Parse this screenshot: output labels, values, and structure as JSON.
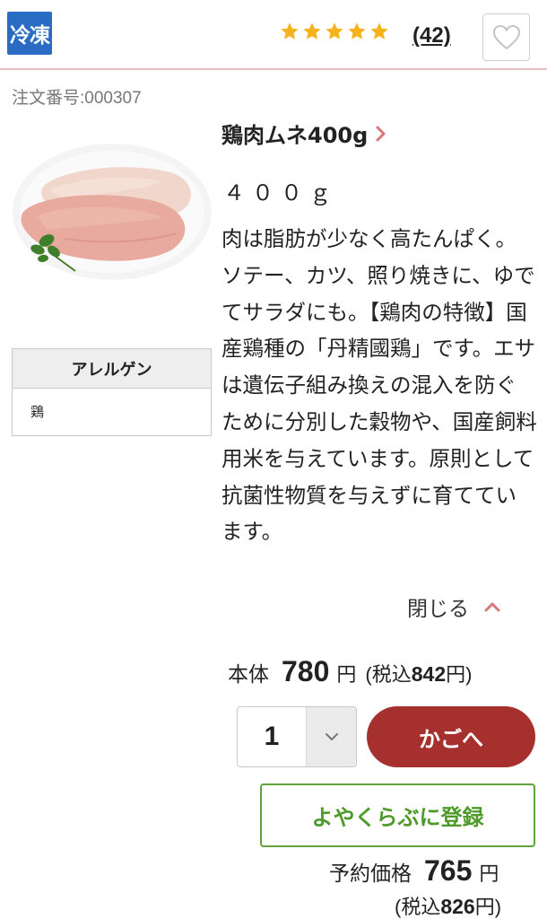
{
  "header": {
    "badge_label": "冷凍",
    "rating": 5,
    "rating_max": 5,
    "review_count": "(42)",
    "favorite_icon": "heart-outline-icon"
  },
  "order_number": "注文番号:000307",
  "allergen": {
    "heading": "アレルゲン",
    "value": "鶏"
  },
  "product": {
    "name": "鶏肉ムネ400g",
    "weight": "４００ｇ",
    "description": "肉は脂肪が少なく高たんぱく。ソテー、カツ、照り焼きに、ゆでてサラダにも。【鶏肉の特徴】国産鶏種の「丹精國鶏」です。エサは遺伝子組み換えの混入を防ぐために分別した穀物や、国産飼料用米を与えています。原則として抗菌性物質を与えずに育てています。",
    "close_label": "閉じる"
  },
  "price": {
    "label": "本体",
    "value": "780",
    "yen": "円",
    "tax_prefix": "(税込",
    "tax_value": "842",
    "tax_suffix": "円)"
  },
  "cart": {
    "quantity": "1",
    "button_label": "かごへ"
  },
  "reserve": {
    "button_label": "よやくらぶに登録",
    "price_label": "予約価格",
    "value": "765",
    "yen": "円",
    "tax_prefix": "(税込",
    "tax_value": "826",
    "tax_suffix": "円)"
  },
  "colors": {
    "badge": "#2a6cc4",
    "star": "#f5b21c",
    "cart_button": "#a6302d",
    "reserve_green": "#5fa33c",
    "divider_pink": "#e8bfc3",
    "chevron": "#d9777d"
  }
}
